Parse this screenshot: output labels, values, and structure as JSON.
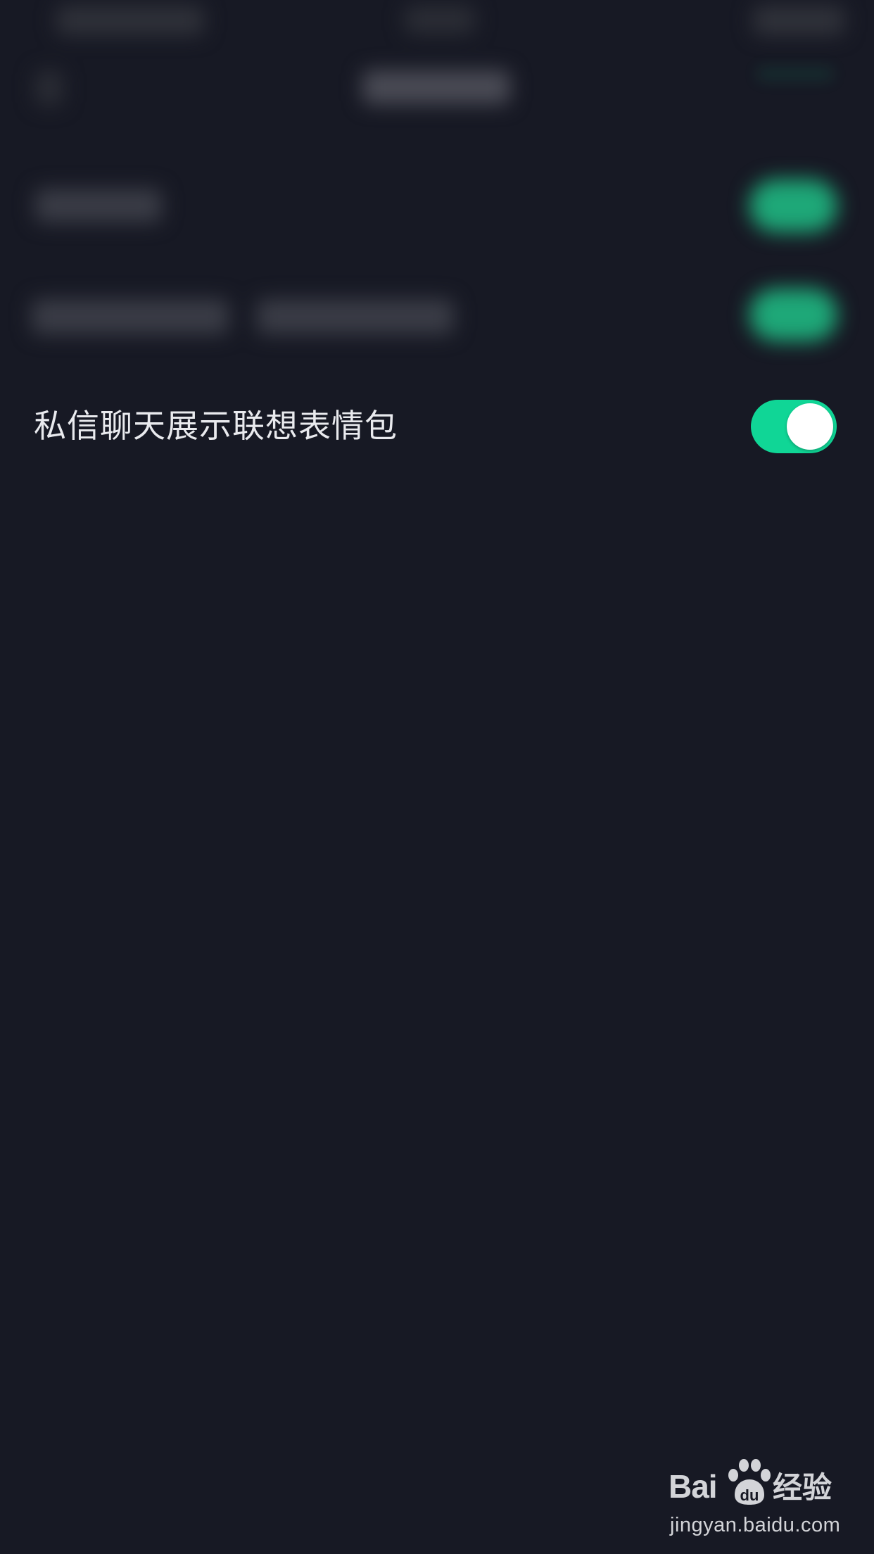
{
  "settings": {
    "visible_row": {
      "label": "私信聊天展示联想表情包",
      "toggle_on": true
    }
  },
  "colors": {
    "background": "#171924",
    "toggle_on": "#10d696",
    "toggle_knob": "#ffffff",
    "label_text": "#e9eaee"
  },
  "icons": {
    "toggle": "toggle-switch-on",
    "watermark_logo": "baidu-paw-icon"
  },
  "watermark": {
    "brand_left": "Bai",
    "brand_right": "du",
    "brand_cn": "经验",
    "url": "jingyan.baidu.com"
  }
}
